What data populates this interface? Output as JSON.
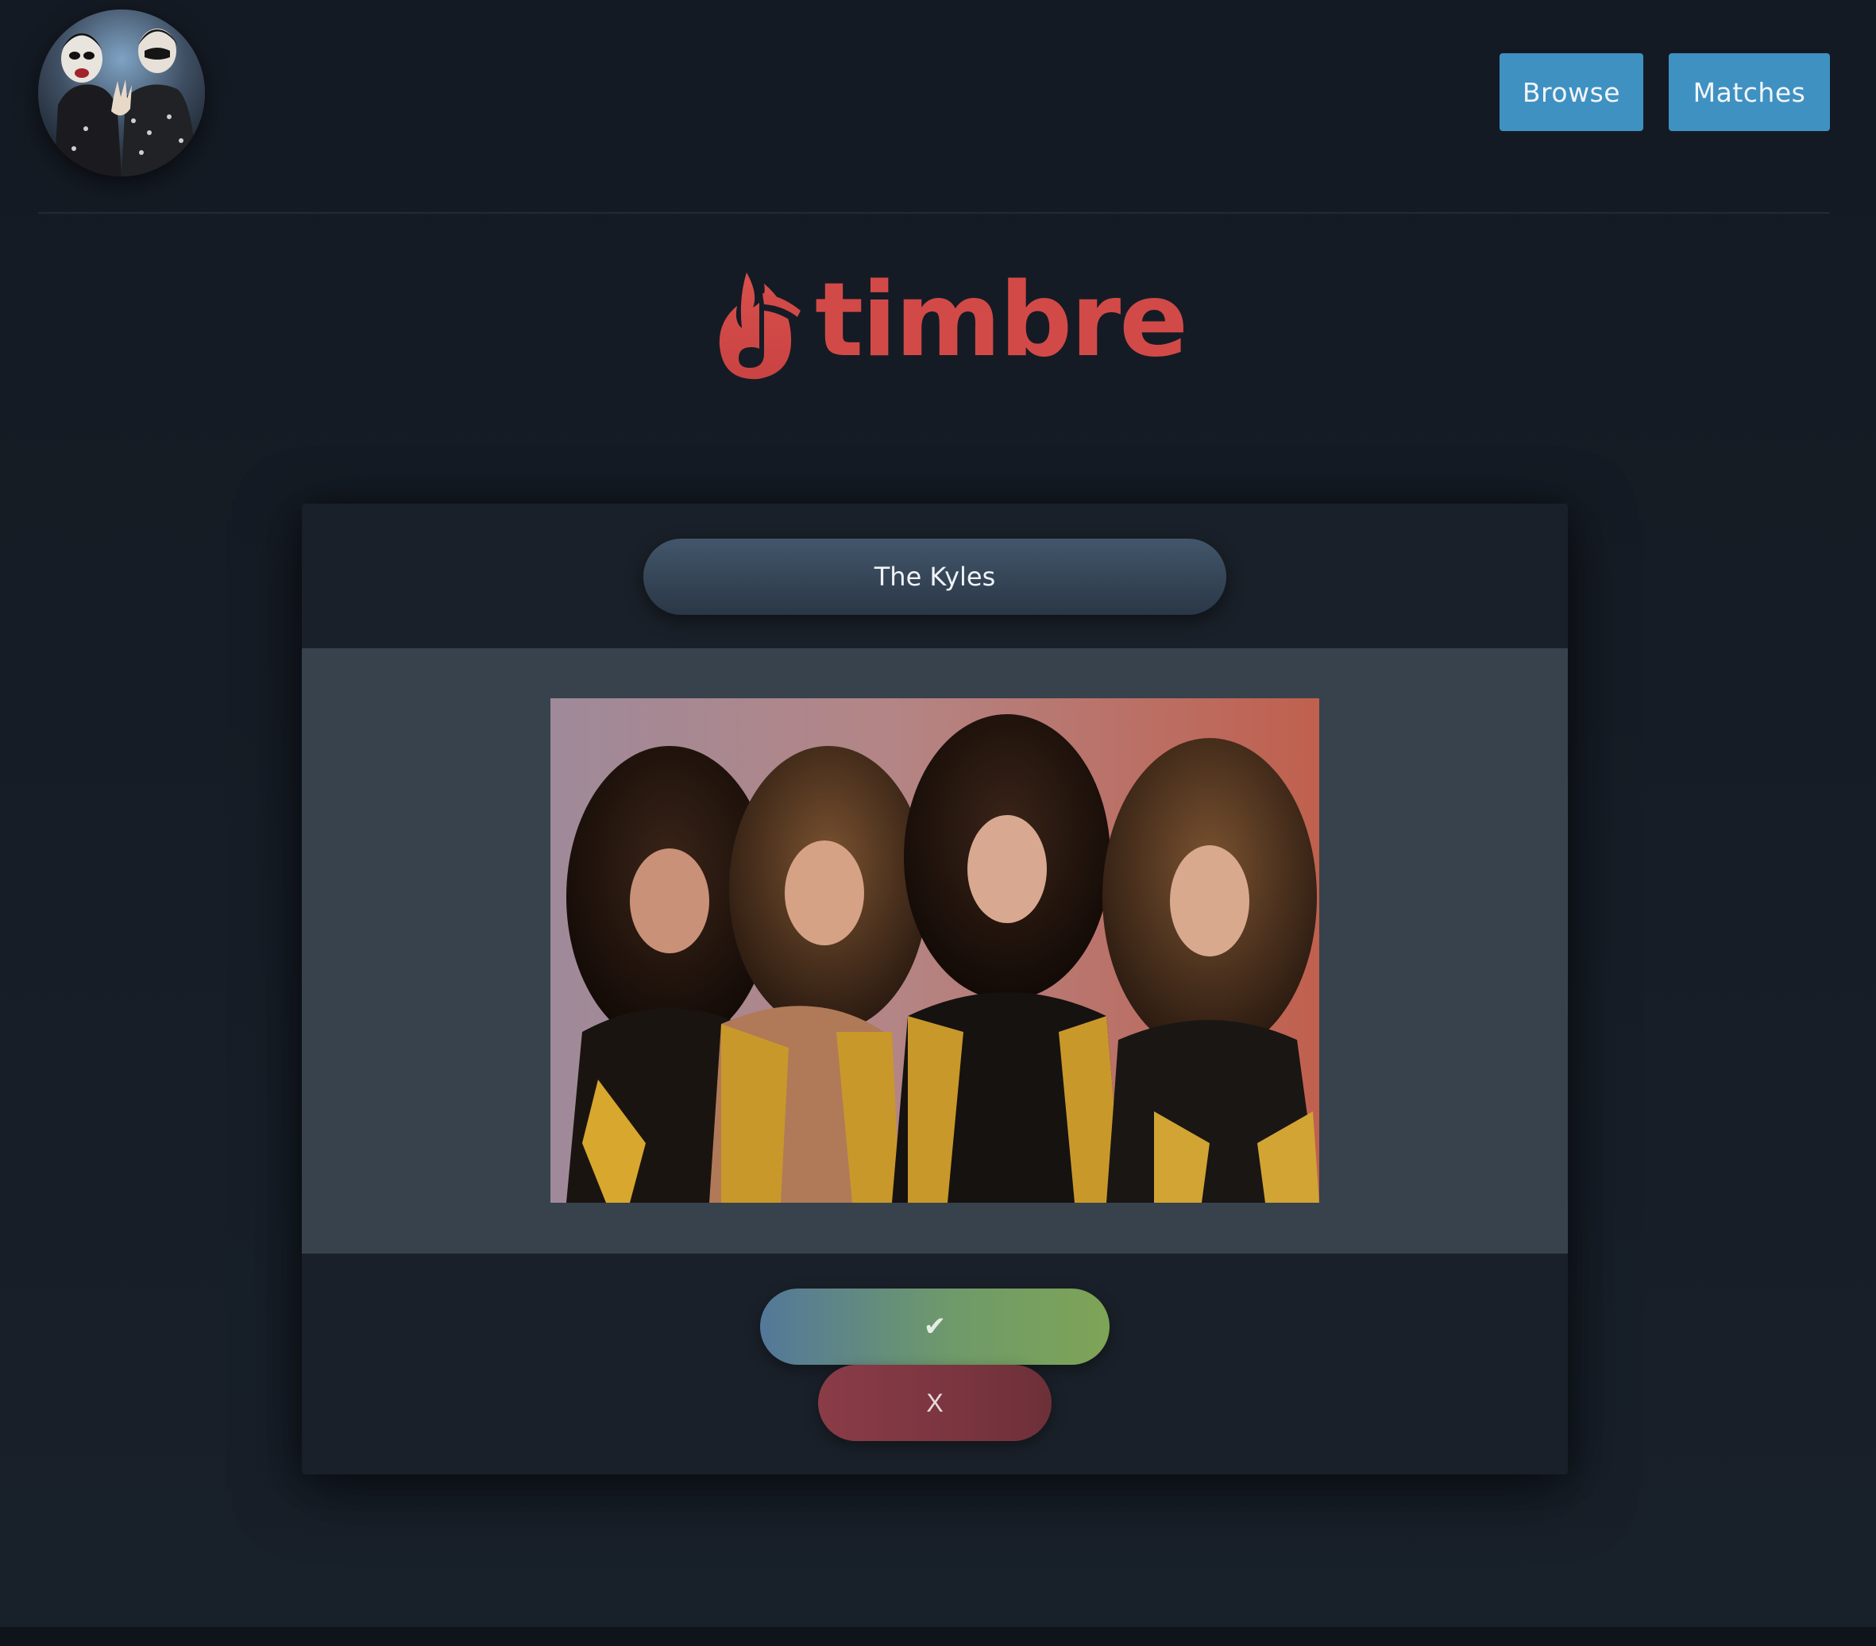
{
  "header": {
    "avatar_icon": "user-avatar",
    "nav": {
      "browse_label": "Browse",
      "matches_label": "Matches"
    }
  },
  "logo": {
    "icon": "flame-music-note-icon",
    "text": "timbre"
  },
  "card": {
    "band_name": "The Kyles",
    "photo_icon": "band-photo",
    "like_label": "✔",
    "nope_label": "X"
  },
  "colors": {
    "background": "#161c25",
    "nav_button": "#3f91c2",
    "brand": "#d24a48",
    "card": "#1a2029",
    "photo_panel": "#37424c",
    "like_gradient_start": "#53789a",
    "like_gradient_end": "#7ea456",
    "nope": "#7a3540"
  }
}
